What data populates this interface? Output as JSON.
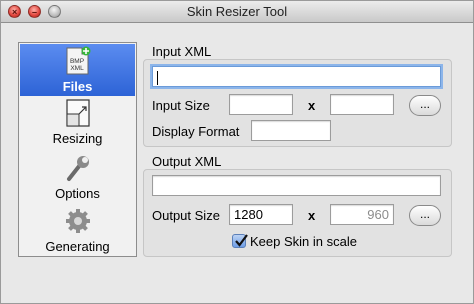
{
  "window": {
    "title": "Skin Resizer Tool",
    "buttons": [
      "close",
      "minimize",
      "zoom"
    ]
  },
  "sidebar": {
    "items": [
      {
        "label": "Files",
        "icon": "bmp-xml-file-icon",
        "selected": true
      },
      {
        "label": "Resizing",
        "icon": "resize-icon",
        "selected": false
      },
      {
        "label": "Options",
        "icon": "wrench-icon",
        "selected": false
      },
      {
        "label": "Generating",
        "icon": "gear-icon",
        "selected": false
      }
    ]
  },
  "input_section": {
    "title": "Input XML",
    "path_value": "",
    "size_label": "Input Size",
    "width_value": "",
    "height_value": "",
    "times": "x",
    "browse_label": "...",
    "display_format_label": "Display Format",
    "display_format_value": ""
  },
  "output_section": {
    "title": "Output XML",
    "path_value": "",
    "size_label": "Output Size",
    "width_value": "1280",
    "height_value": "960",
    "times": "x",
    "browse_label": "...",
    "keep_scale_label": "Keep Skin in scale",
    "keep_scale_checked": true
  },
  "colors": {
    "selection": "#2d63d6",
    "focus_ring": "#8cb5ea"
  }
}
